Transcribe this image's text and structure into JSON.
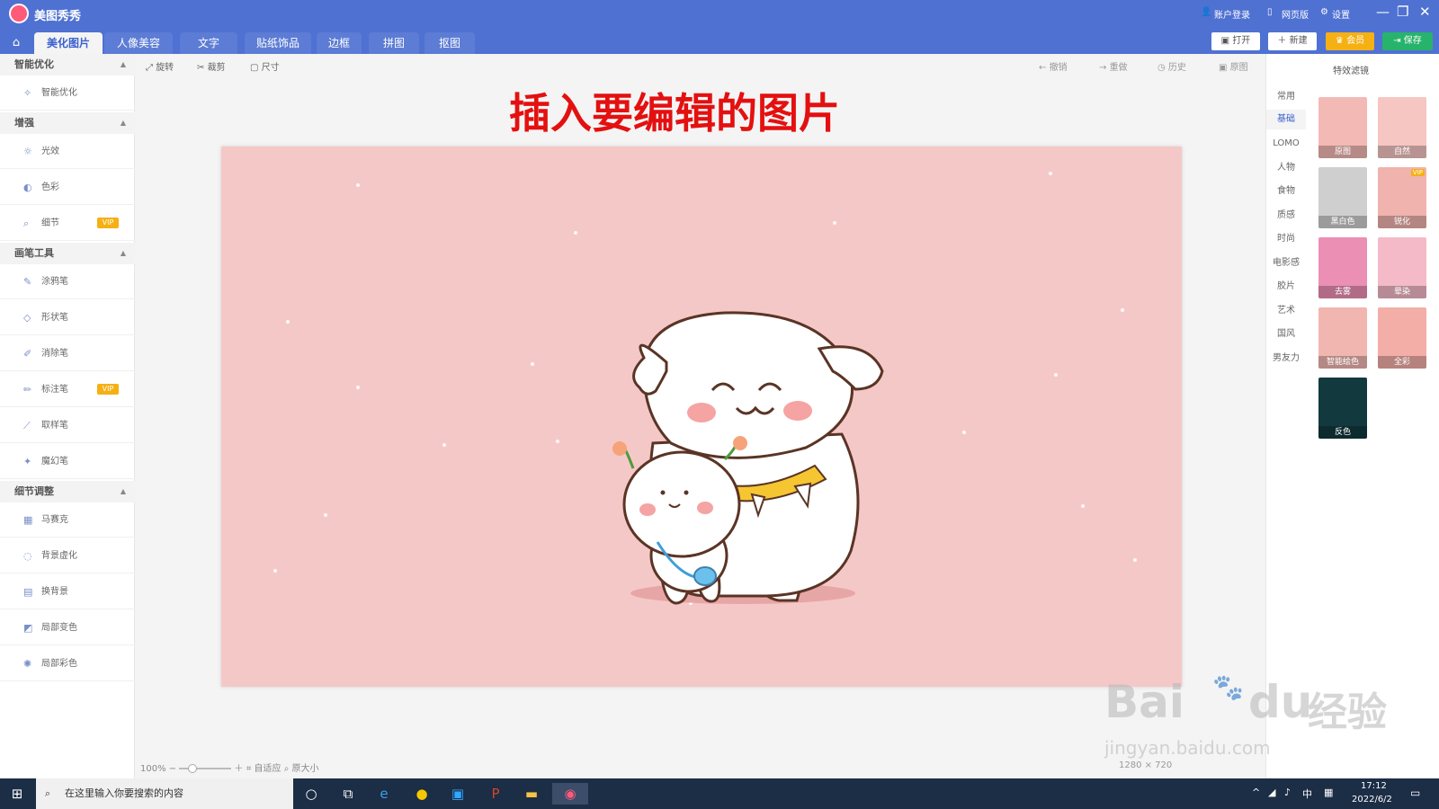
{
  "titlebar": {
    "app_name": "美图秀秀",
    "login": "账户登录",
    "web": "网页版",
    "settings": "设置"
  },
  "tabs": [
    "美化图片",
    "人像美容",
    "文字",
    "贴纸饰品",
    "边框",
    "拼图",
    "抠图"
  ],
  "top_buttons": {
    "open": "打开",
    "new": "新建",
    "vip": "会员",
    "save": "保存"
  },
  "sidebar": {
    "sections": [
      {
        "title": "智能优化",
        "items": [
          {
            "label": "智能优化",
            "vip": ""
          }
        ]
      },
      {
        "title": "增强",
        "items": [
          {
            "label": "光效",
            "vip": ""
          },
          {
            "label": "色彩",
            "vip": ""
          },
          {
            "label": "细节",
            "vip": "VIP"
          }
        ]
      },
      {
        "title": "画笔工具",
        "items": [
          {
            "label": "涂鸦笔",
            "vip": ""
          },
          {
            "label": "形状笔",
            "vip": ""
          },
          {
            "label": "消除笔",
            "vip": ""
          },
          {
            "label": "标注笔",
            "vip": "VIP"
          },
          {
            "label": "取样笔",
            "vip": ""
          },
          {
            "label": "魔幻笔",
            "vip": ""
          }
        ]
      },
      {
        "title": "细节调整",
        "items": [
          {
            "label": "马赛克",
            "vip": ""
          },
          {
            "label": "背景虚化",
            "vip": ""
          },
          {
            "label": "换背景",
            "vip": ""
          },
          {
            "label": "局部变色",
            "vip": ""
          },
          {
            "label": "局部彩色",
            "vip": ""
          }
        ]
      }
    ]
  },
  "toolbar": {
    "rotate": "旋转",
    "crop": "裁剪",
    "size": "尺寸",
    "undo": "撤销",
    "redo": "重做",
    "history": "历史",
    "original": "原图"
  },
  "headline": "插入要编辑的图片",
  "zoom": {
    "level": "100%",
    "fit": "自适应",
    "actual": "原大小"
  },
  "image_size": "1280 × 720",
  "right_panel": {
    "title": "特效滤镜",
    "categories": [
      "常用",
      "基础",
      "LOMO",
      "人物",
      "食物",
      "质感",
      "时尚",
      "电影感",
      "胶片",
      "艺术",
      "国风",
      "男友力"
    ],
    "active_category": "基础",
    "filters": [
      {
        "label": "原图",
        "vip": ""
      },
      {
        "label": "自然",
        "vip": ""
      },
      {
        "label": "黑白色",
        "vip": ""
      },
      {
        "label": "锐化",
        "vip": "VIP"
      },
      {
        "label": "去雾",
        "vip": ""
      },
      {
        "label": "晕染",
        "vip": ""
      },
      {
        "label": "智能绘色",
        "vip": ""
      },
      {
        "label": "全彩",
        "vip": ""
      },
      {
        "label": "反色",
        "vip": ""
      }
    ]
  },
  "taskbar": {
    "search_placeholder": "在这里输入你要搜索的内容",
    "time": "17:12",
    "date": "2022/6/2",
    "ime": "中"
  },
  "watermark": {
    "brand": "Bai",
    "brand2": "du",
    "cn": "经验",
    "url": "jingyan.baidu.com"
  },
  "colors": {
    "titlebar": "#4f71d2",
    "headline": "#e41010",
    "photo_bg": "#f5c8c8",
    "vip": "#f5b014",
    "save": "#27b36b"
  }
}
